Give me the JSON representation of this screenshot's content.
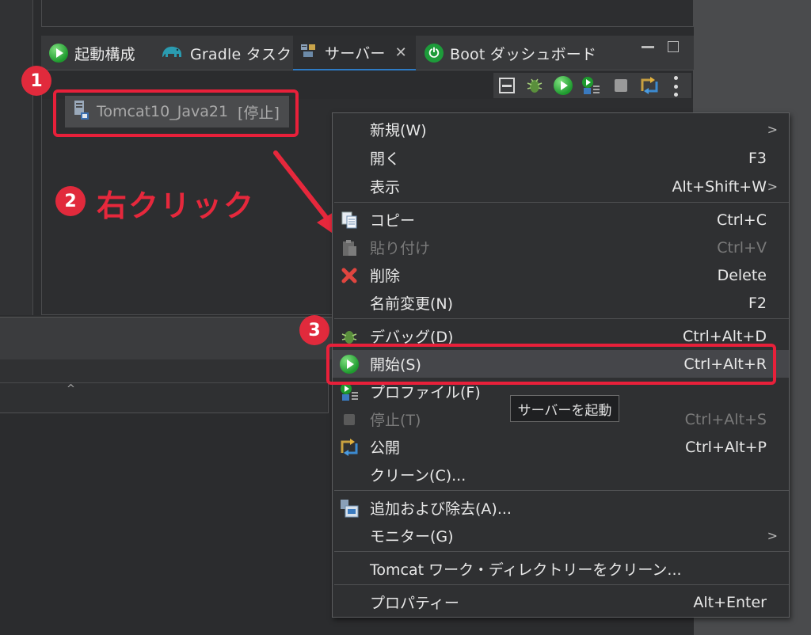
{
  "tabs": [
    {
      "label": "起動構成",
      "icon": "play-icon"
    },
    {
      "label": "Gradle タスク",
      "icon": "elephant-icon"
    },
    {
      "label": "サーバー",
      "icon": "servers-icon",
      "active": true
    },
    {
      "label": "Boot ダッシュボード",
      "icon": "power-icon"
    }
  ],
  "server": {
    "name": "Tomcat10_Java21",
    "state": "[停止]"
  },
  "callouts": {
    "one": "1",
    "two": "2",
    "three": "3",
    "right_click": "右クリック"
  },
  "menu": {
    "new": {
      "label": "新規(W)"
    },
    "open": {
      "label": "開く",
      "shortcut": "F3"
    },
    "show": {
      "label": "表示",
      "shortcut": "Alt+Shift+W"
    },
    "copy": {
      "label": "コピー",
      "shortcut": "Ctrl+C"
    },
    "paste": {
      "label": "貼り付け",
      "shortcut": "Ctrl+V"
    },
    "delete": {
      "label": "削除",
      "shortcut": "Delete"
    },
    "rename": {
      "label": "名前変更(N)",
      "shortcut": "F2"
    },
    "debug": {
      "label": "デバッグ(D)",
      "shortcut": "Ctrl+Alt+D"
    },
    "start": {
      "label": "開始(S)",
      "shortcut": "Ctrl+Alt+R"
    },
    "profile": {
      "label": "プロファイル(F)"
    },
    "stop": {
      "label": "停止(T)",
      "shortcut": "Ctrl+Alt+S"
    },
    "publish": {
      "label": "公開",
      "shortcut": "Ctrl+Alt+P"
    },
    "clean": {
      "label": "クリーン(C)..."
    },
    "add_remove": {
      "label": "追加および除去(A)..."
    },
    "monitor": {
      "label": "モニター(G)"
    },
    "clean_workdir": {
      "label": "Tomcat ワーク・ディレクトリーをクリーン..."
    },
    "properties": {
      "label": "プロパティー",
      "shortcut": "Alt+Enter"
    }
  },
  "tooltip": "サーバーを起動",
  "colors": {
    "accent_red": "#e8203a",
    "highlight": "#45464a",
    "tab_active_line": "#2e7bc4"
  }
}
